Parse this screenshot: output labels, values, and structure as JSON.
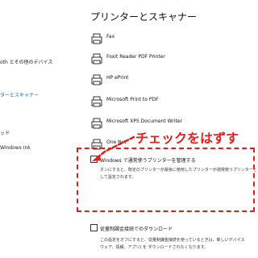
{
  "sidebar": {
    "items": [
      {
        "label": "oth とその他のデバイス",
        "active": false
      },
      {
        "label": "ターとスキャナー",
        "active": true
      },
      {
        "label": "ッド",
        "active": false
      },
      {
        "label": "Windows Ink",
        "active": false
      }
    ]
  },
  "main": {
    "title": "プリンターとスキャナー",
    "printers": [
      {
        "name": "Fax",
        "icon": "fax-icon"
      },
      {
        "name": "Foxit Reader PDF Printer",
        "icon": "printer-icon"
      },
      {
        "name": "HP ePrint",
        "icon": "printer-icon"
      },
      {
        "name": "Microsoft Print to PDF",
        "icon": "printer-icon"
      },
      {
        "name": "Microsoft XPS Document Writer",
        "icon": "printer-icon"
      },
      {
        "name": "One Not",
        "icon": "printer-icon"
      }
    ],
    "options": [
      {
        "title": "Windows で通常使うプリンターを管理する",
        "checked": false,
        "desc": [
          "オンにすると、既定のプリンターが最後に使用したプリンターが通常使うプリンターと",
          "して設定されます。"
        ]
      },
      {
        "title": "従量制課金接続でのダウンロード",
        "checked": false,
        "desc": [
          "この設定をオフにすると、従量制課金接続を使っているときは、新しいデバイス",
          "ウェア、情報、アプリ) を ダウンロードされなくなります。"
        ]
      }
    ]
  },
  "annotation": {
    "label": "チェックをはずす",
    "color": "#e01f1f"
  },
  "colors": {
    "accent": "#0a64c8",
    "annotation": "#e01f1f"
  }
}
